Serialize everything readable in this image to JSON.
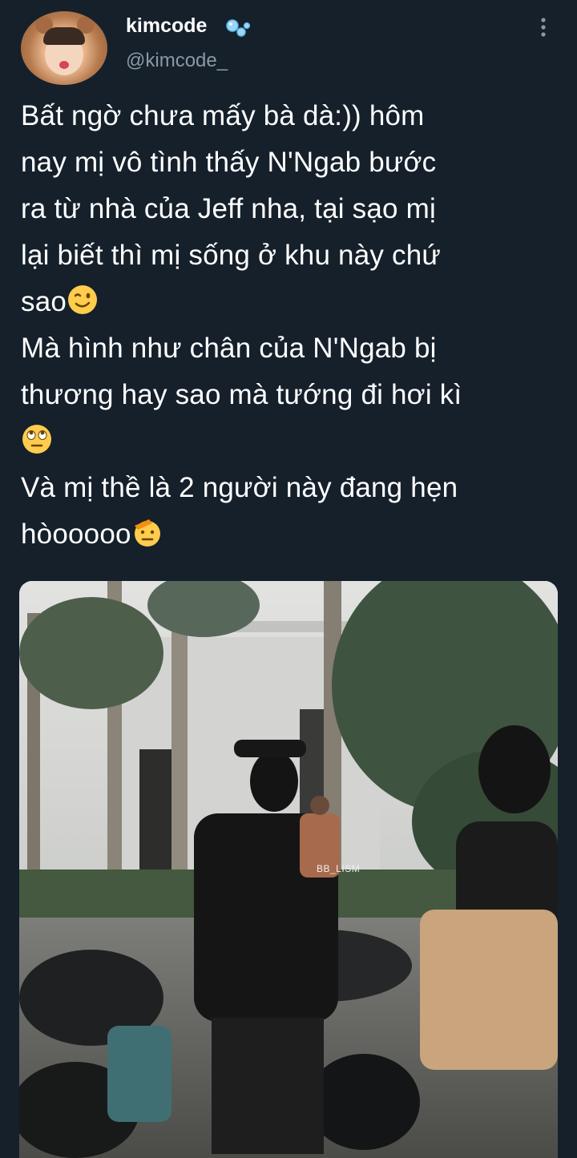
{
  "tweet": {
    "display_name": "kimcode",
    "handle": "@kimcode_",
    "text_lines": [
      "Bất ngờ chưa mấy bà dà:)) hôm",
      "nay mị vô tình thấy N'Ngab bước",
      "ra từ nhà của Jeff nha, tại sạo mị",
      "lại biết thì mị sống ở khu này chứ",
      "sao",
      "Mà hình như chân của N'Ngab bị",
      "thương hay sao mà tướng đi hơi kì",
      "",
      "Và mị thề là 2 người này đang hẹn",
      "hòooooo"
    ],
    "icons": {
      "verified": "bubbles-badge-icon",
      "more": "more-vertical-icon",
      "emoji_1": "winking-face-icon",
      "emoji_2": "rolling-eyes-face-icon",
      "emoji_3": "saluting-face-icon"
    }
  },
  "media": {
    "watermark": "BB_LISM"
  },
  "colors": {
    "background": "#15202b",
    "text": "#ffffff",
    "secondary_text": "#8b98a5"
  }
}
